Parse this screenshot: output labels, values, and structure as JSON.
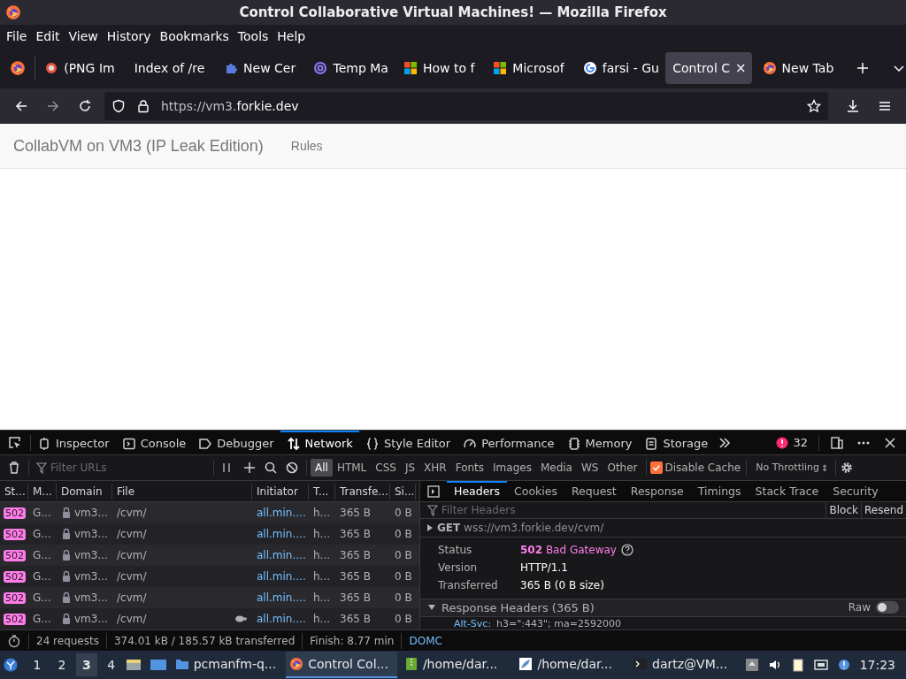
{
  "window": {
    "title": "Control Collaborative Virtual Machines! — Mozilla Firefox"
  },
  "menu": [
    "File",
    "Edit",
    "View",
    "History",
    "Bookmarks",
    "Tools",
    "Help"
  ],
  "tabs": [
    {
      "label": "(PNG Im",
      "kind": "ring",
      "selected": false
    },
    {
      "label": "Index of /re",
      "kind": "plain",
      "selected": false
    },
    {
      "label": "New Cer",
      "kind": "puzzle",
      "selected": false
    },
    {
      "label": "Temp Ma",
      "kind": "at",
      "selected": false
    },
    {
      "label": "How to f",
      "kind": "squares",
      "selected": false
    },
    {
      "label": "Microsof",
      "kind": "squares",
      "selected": false
    },
    {
      "label": "farsi - Gu",
      "kind": "g",
      "selected": false
    },
    {
      "label": "Control C",
      "kind": "plain",
      "selected": true
    },
    {
      "label": "New Tab",
      "kind": "fox",
      "selected": false
    }
  ],
  "close_tab": "×",
  "url": {
    "prefix": "https://vm3.",
    "domain": "forkie.dev"
  },
  "page": {
    "brand": "CollabVM on VM3 (IP Leak Edition)",
    "links": [
      "Rules"
    ]
  },
  "devtools": {
    "tools": [
      {
        "label": "Inspector",
        "kind": "inspector",
        "selected": false
      },
      {
        "label": "Console",
        "kind": "console",
        "selected": false
      },
      {
        "label": "Debugger",
        "kind": "debugger",
        "selected": false
      },
      {
        "label": "Network",
        "kind": "network",
        "selected": true
      },
      {
        "label": "Style Editor",
        "kind": "braces",
        "selected": false
      },
      {
        "label": "Performance",
        "kind": "gauge",
        "selected": false
      },
      {
        "label": "Memory",
        "kind": "chip",
        "selected": false
      },
      {
        "label": "Storage",
        "kind": "storage",
        "selected": false
      }
    ],
    "error_count": "32",
    "filter_placeholder": "Filter URLs",
    "type_filters": [
      {
        "label": "All",
        "selected": true
      },
      {
        "label": "HTML",
        "selected": false
      },
      {
        "label": "CSS",
        "selected": false
      },
      {
        "label": "JS",
        "selected": false
      },
      {
        "label": "XHR",
        "selected": false
      },
      {
        "label": "Fonts",
        "selected": false
      },
      {
        "label": "Images",
        "selected": false
      },
      {
        "label": "Media",
        "selected": false
      },
      {
        "label": "WS",
        "selected": false
      },
      {
        "label": "Other",
        "selected": false
      }
    ],
    "disable_cache": {
      "label": "Disable Cache",
      "checked": true
    },
    "throttling": "No Throttling",
    "throttling_arrow": "⇕",
    "columns": [
      "St...",
      "M...",
      "Domain",
      "File",
      "Initiator",
      "T...",
      "Transfe...",
      "Si..."
    ],
    "rows": [
      {
        "status": "502",
        "method": "G...",
        "domain": "vm3...",
        "file": "/cvm/",
        "initiator": "all.min....",
        "type": "h...",
        "transferred": "365 B",
        "size": "0 B",
        "slow": false,
        "selected": false
      },
      {
        "status": "502",
        "method": "G...",
        "domain": "vm3...",
        "file": "/cvm/",
        "initiator": "all.min....",
        "type": "h...",
        "transferred": "365 B",
        "size": "0 B",
        "slow": false,
        "selected": false
      },
      {
        "status": "502",
        "method": "G...",
        "domain": "vm3...",
        "file": "/cvm/",
        "initiator": "all.min....",
        "type": "h...",
        "transferred": "365 B",
        "size": "0 B",
        "slow": false,
        "selected": false
      },
      {
        "status": "502",
        "method": "G...",
        "domain": "vm3...",
        "file": "/cvm/",
        "initiator": "all.min....",
        "type": "h...",
        "transferred": "365 B",
        "size": "0 B",
        "slow": false,
        "selected": false
      },
      {
        "status": "502",
        "method": "G...",
        "domain": "vm3...",
        "file": "/cvm/",
        "initiator": "all.min....",
        "type": "h...",
        "transferred": "365 B",
        "size": "0 B",
        "slow": false,
        "selected": false
      },
      {
        "status": "502",
        "method": "G...",
        "domain": "vm3...",
        "file": "/cvm/",
        "initiator": "all.min....",
        "type": "h...",
        "transferred": "365 B",
        "size": "0 B",
        "slow": true,
        "selected": false
      }
    ],
    "detail_tabs": [
      {
        "label": "Headers",
        "selected": true
      },
      {
        "label": "Cookies",
        "selected": false
      },
      {
        "label": "Request",
        "selected": false
      },
      {
        "label": "Response",
        "selected": false
      },
      {
        "label": "Timings",
        "selected": false
      },
      {
        "label": "Stack Trace",
        "selected": false
      },
      {
        "label": "Security",
        "selected": false
      }
    ],
    "filter_headers_placeholder": "Filter Headers",
    "header_buttons": [
      "Block",
      "Resend"
    ],
    "request": {
      "method": "GET",
      "url": "wss://vm3.forkie.dev/cvm/"
    },
    "status": {
      "label": "Status",
      "code": "502",
      "text": "Bad Gateway"
    },
    "fields": [
      {
        "label": "Version",
        "value": "HTTP/1.1"
      },
      {
        "label": "Transferred",
        "value": "365 B (0 B size)"
      }
    ],
    "response_headers": {
      "title": "Response Headers (365 B)",
      "expanded": true,
      "raw_label": "Raw",
      "raw_on": false,
      "first": {
        "name": "Alt-Svc:",
        "value": "h3=\":443\"; ma=2592000"
      }
    },
    "status_bar": [
      "24 requests",
      "374.01 kB / 185.57 kB transferred",
      "Finish: 8.77 min",
      "DOMC"
    ]
  },
  "taskbar": {
    "workspaces": [
      {
        "label": "1",
        "selected": false
      },
      {
        "label": "2",
        "selected": false
      },
      {
        "label": "3",
        "selected": true
      },
      {
        "label": "4",
        "selected": false
      }
    ],
    "tasks": [
      {
        "label": "pcmanfm-q...",
        "kind": "folder",
        "active": false
      },
      {
        "label": "Control Col...",
        "kind": "fox",
        "active": true
      },
      {
        "label": "/home/dar...",
        "kind": "archive",
        "active": false
      },
      {
        "label": "/home/dar...",
        "kind": "feather",
        "active": false
      },
      {
        "label": "dartz@VM...",
        "kind": "terminal",
        "active": false
      }
    ],
    "clock": "17:23"
  }
}
